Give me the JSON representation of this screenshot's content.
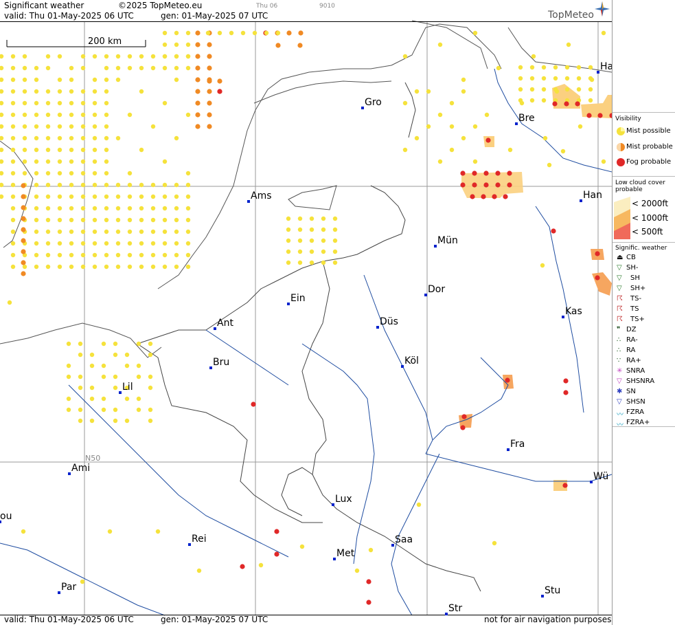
{
  "header": {
    "title": "Significant weather",
    "copyright": "©2025 TopMeteo.eu",
    "day_tag": "Thu 06",
    "code": "9010",
    "valid": "valid:  Thu  01-May-2025  06 UTC",
    "generated": "gen: 01-May-2025 07 UTC",
    "brand": "TopMeteo"
  },
  "footer": {
    "valid": "valid:  Thu  01-May-2025  06 UTC",
    "generated": "gen: 01-May-2025 07 UTC",
    "disclaimer": "not for air navigation purposes"
  },
  "map": {
    "scale_label": "200 km",
    "grid_label": "N50",
    "cities": [
      {
        "name": "Gro"
      },
      {
        "name": "Bre"
      },
      {
        "name": "Ha"
      },
      {
        "name": "Ams"
      },
      {
        "name": "Han"
      },
      {
        "name": "Mün"
      },
      {
        "name": "Dor"
      },
      {
        "name": "Ein"
      },
      {
        "name": "Kas"
      },
      {
        "name": "Ant"
      },
      {
        "name": "Düs"
      },
      {
        "name": "Bru"
      },
      {
        "name": "Köl"
      },
      {
        "name": "Lil"
      },
      {
        "name": "Fra"
      },
      {
        "name": "Ami"
      },
      {
        "name": "Wü"
      },
      {
        "name": "ou"
      },
      {
        "name": "Lux"
      },
      {
        "name": "Rei"
      },
      {
        "name": "Saa"
      },
      {
        "name": "Met"
      },
      {
        "name": "Par"
      },
      {
        "name": "Stu"
      },
      {
        "name": "Str"
      }
    ],
    "colors": {
      "mist_possible": "#f5e23c",
      "mist_probable": "#f08a24",
      "fog_probable": "#e02828",
      "cloud_2000": "#fbeec0",
      "cloud_1000": "#f7b860",
      "cloud_500": "#f06a5a",
      "water": "#1e4ca0",
      "border": "#444444",
      "coast": "#555555",
      "city": "#0022cc"
    }
  },
  "legend": {
    "visibility_title": "Visibility",
    "visibility": [
      {
        "label": "Mist possible",
        "icon": "mist-possible-icon"
      },
      {
        "label": "Mist probable",
        "icon": "mist-probable-icon"
      },
      {
        "label": "Fog probable",
        "icon": "fog-probable-icon"
      }
    ],
    "cloud_title_1": "Low cloud cover",
    "cloud_title_2": "probable",
    "cloud": [
      {
        "label": "< 2000ft"
      },
      {
        "label": "< 1000ft"
      },
      {
        "label": "<   500ft"
      }
    ],
    "signif_title": "Signific. weather",
    "signif": [
      {
        "label": "CB",
        "icon": "cb-icon"
      },
      {
        "label": "SH-",
        "icon": "light-shower-icon"
      },
      {
        "label": "SH",
        "icon": "shower-icon"
      },
      {
        "label": "SH+",
        "icon": "heavy-shower-icon"
      },
      {
        "label": "TS-",
        "icon": "light-thunderstorm-icon"
      },
      {
        "label": "TS",
        "icon": "thunderstorm-icon"
      },
      {
        "label": "TS+",
        "icon": "heavy-thunderstorm-icon"
      },
      {
        "label": "DZ",
        "icon": "drizzle-icon"
      },
      {
        "label": "RA-",
        "icon": "light-rain-icon"
      },
      {
        "label": "RA",
        "icon": "rain-icon"
      },
      {
        "label": "RA+",
        "icon": "heavy-rain-icon"
      },
      {
        "label": "SNRA",
        "icon": "snow-rain-icon"
      },
      {
        "label": "SHSNRA",
        "icon": "snow-rain-shower-icon"
      },
      {
        "label": "SN",
        "icon": "snow-icon"
      },
      {
        "label": "SHSN",
        "icon": "snow-shower-icon"
      },
      {
        "label": "FZRA",
        "icon": "freezing-rain-icon"
      },
      {
        "label": "FZRA+",
        "icon": "heavy-freezing-rain-icon"
      }
    ]
  }
}
